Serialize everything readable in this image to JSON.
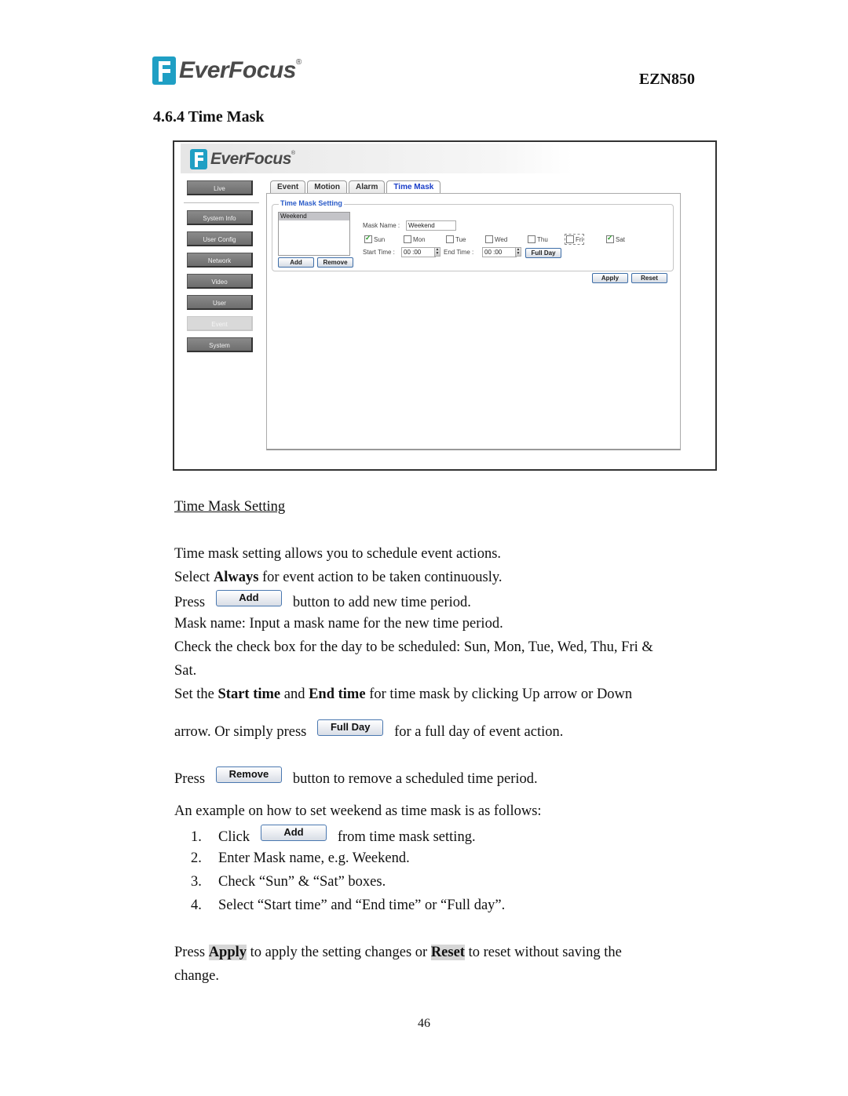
{
  "header": {
    "brand": "EverFocus",
    "registered": "®",
    "model": "EZN850",
    "section_title": "4.6.4 Time Mask"
  },
  "colors": {
    "brand_blue": "#1f9fc4",
    "active_tab": "#1a3ec8",
    "legend_blue": "#2a5bc8",
    "checkbox_check": "#2a9a2a"
  },
  "screenshot": {
    "brand": "EverFocus",
    "registered": "®",
    "sidebar": {
      "items": [
        {
          "label": "Live",
          "active": false
        },
        {
          "label": "System Info",
          "active": false
        },
        {
          "label": "User Config",
          "active": false
        },
        {
          "label": "Network",
          "active": false
        },
        {
          "label": "Video",
          "active": false
        },
        {
          "label": "User",
          "active": false
        },
        {
          "label": "Event",
          "active": true
        },
        {
          "label": "System",
          "active": false
        }
      ]
    },
    "tabs": [
      {
        "label": "Event",
        "active": false
      },
      {
        "label": "Motion",
        "active": false
      },
      {
        "label": "Alarm",
        "active": false
      },
      {
        "label": "Time Mask",
        "active": true
      }
    ],
    "time_mask_setting": {
      "legend": "Time Mask Setting",
      "mask_list": [
        "Weekend"
      ],
      "add_label": "Add",
      "remove_label": "Remove",
      "mask_name_label": "Mask Name :",
      "mask_name_value": "Weekend",
      "days": [
        {
          "label": "Sun",
          "checked": true
        },
        {
          "label": "Mon",
          "checked": false
        },
        {
          "label": "Tue",
          "checked": false
        },
        {
          "label": "Wed",
          "checked": false
        },
        {
          "label": "Thu",
          "checked": false
        },
        {
          "label": "Fri",
          "checked": false
        },
        {
          "label": "Sat",
          "checked": true
        }
      ],
      "start_time_label": "Start Time :",
      "start_time_value": "00 :00",
      "end_time_label": "End Time :",
      "end_time_value": "00 :00",
      "full_day_label": "Full Day",
      "spin_up": "▲",
      "spin_down": "▼"
    },
    "apply_label": "Apply",
    "reset_label": "Reset"
  },
  "body": {
    "subheading": "Time Mask Setting",
    "p1": "Time mask setting allows you to schedule event actions.",
    "p2_pre": "Select ",
    "p2_bold": "Always",
    "p2_post": " for event action to be taken continuously.",
    "p3_pre": "Press",
    "p3_btn": "Add",
    "p3_post": "button to add new time period.",
    "p4": "Mask name: Input a mask name for the new time period.",
    "p5a": "Check the check box for the day to be scheduled: Sun, Mon, Tue, Wed, Thu, Fri &",
    "p5b": "Sat.",
    "p6_pre": "Set the ",
    "p6_bold1": "Start time",
    "p6_mid": " and ",
    "p6_bold2": "End time",
    "p6_post": " for time mask by clicking Up arrow or Down",
    "p7_pre": "arrow. Or simply press",
    "p7_btn": "Full Day",
    "p7_post": "for a full day of event action.",
    "p8_pre": "Press",
    "p8_btn": "Remove",
    "p8_post": "button to remove a scheduled time period.",
    "example_intro": "An example on how to set weekend as time mask is as follows:",
    "steps": [
      {
        "num": "1.",
        "pre": "Click",
        "btn": "Add",
        "post": "from time mask setting."
      },
      {
        "num": "2.",
        "text": "Enter Mask name, e.g. Weekend."
      },
      {
        "num": "3.",
        "text": "Check “Sun” & “Sat” boxes."
      },
      {
        "num": "4.",
        "text": "Select “Start time” and “End time” or “Full day”."
      }
    ],
    "final_pre": "Press ",
    "final_apply": "Apply",
    "final_mid": " to apply the setting changes or ",
    "final_reset": "Reset",
    "final_post": " to reset without saving the",
    "final_line2": "change."
  },
  "page_number": "46"
}
